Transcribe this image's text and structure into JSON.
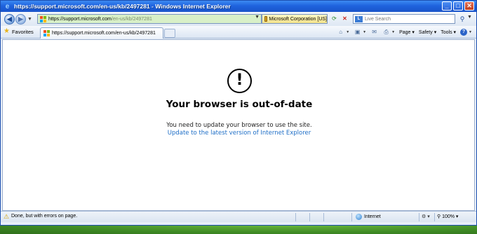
{
  "window": {
    "title": "https://support.microsoft.com/en-us/kb/2497281 - Windows Internet Explorer",
    "minimize_glyph": "_",
    "maximize_glyph": "□",
    "close_glyph": "✕"
  },
  "navbar": {
    "address_prefix": "https://",
    "address_host": "support.microsoft.com",
    "address_path": "/en-us/kb/2497281",
    "certificate_label": "Microsoft Corporation [US]",
    "search_label": "Live Search",
    "search_placeholder": "Live Search"
  },
  "commandbar": {
    "favorites_label": "Favorites",
    "tab_label": "https://support.microsoft.com/en-us/kb/2497281",
    "page_label": "Page",
    "safety_label": "Safety",
    "tools_label": "Tools"
  },
  "content": {
    "alert_glyph": "!",
    "heading": "Your browser is out-of-date",
    "message": "You need to update your browser to use the site.",
    "update_link": "Update to the latest version of Internet Explorer"
  },
  "status": {
    "text": "Done, but with errors on page.",
    "zone": "Internet",
    "zoom": "100%"
  },
  "colors": {
    "link": "#1f6fc7",
    "titlebar": "#1f63de",
    "address_secure_bg": "#d8f0c8"
  },
  "icons": [
    "back-arrow-icon",
    "forward-arrow-icon",
    "windows-flag-icon",
    "padlock-icon",
    "refresh-icon",
    "stop-icon",
    "live-search-icon",
    "magnifier-icon",
    "favorites-star-icon",
    "home-icon",
    "feeds-icon",
    "mail-icon",
    "print-icon",
    "help-icon",
    "warning-icon",
    "globe-icon",
    "alert-circle-icon"
  ]
}
